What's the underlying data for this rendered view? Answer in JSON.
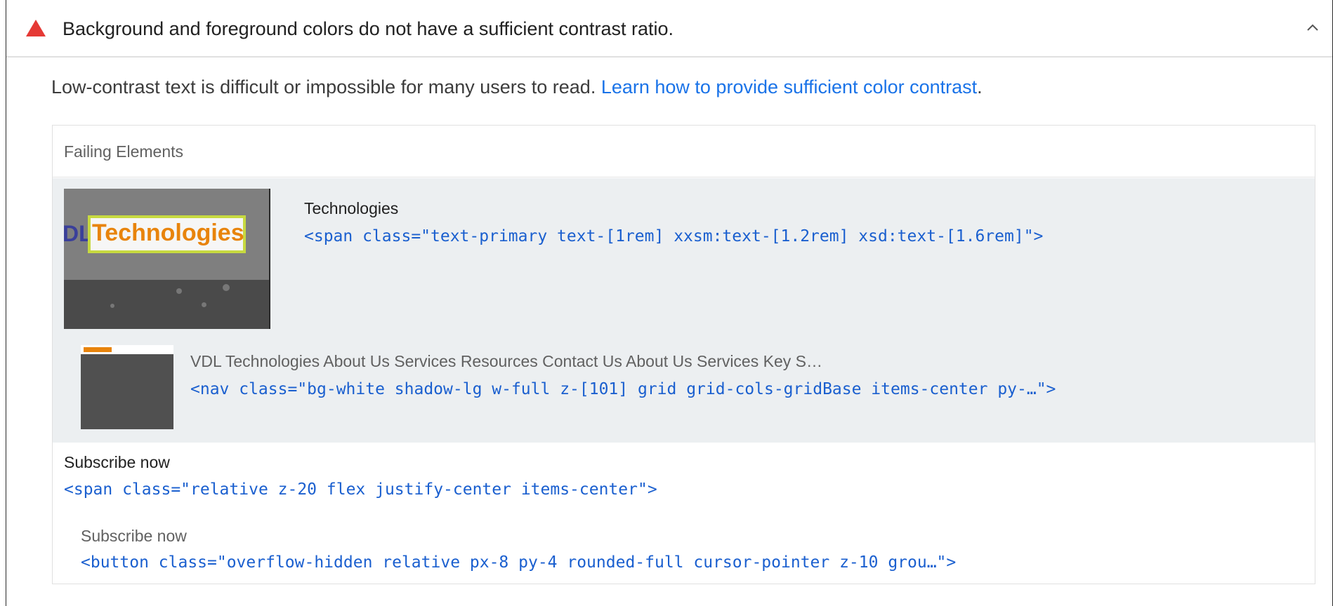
{
  "audit": {
    "title": "Background and foreground colors do not have a sufficient contrast ratio.",
    "description": "Low-contrast text is difficult or impossible for many users to read. ",
    "learn_link": "Learn how to provide sufficient color contrast",
    "description_end": ".",
    "status_color": "#e53935",
    "link_color": "#1a73e8"
  },
  "table": {
    "header": "Failing Elements",
    "rows": [
      {
        "label": "Technologies",
        "snippet": "<span class=\"text-primary text-[1rem] xxsm:text-[1.2rem] xsd:text-[1.6rem]\">",
        "thumb_text_vdl": "DL",
        "thumb_text": "Technologies"
      },
      {
        "label": "VDL Technologies About Us Services Resources Contact Us About Us Services Key S…",
        "snippet": "<nav class=\"bg-white shadow-lg w-full z-[101] grid grid-cols-gridBase items-center py-…\">"
      },
      {
        "label": "Subscribe now",
        "snippet": "<span class=\"relative z-20 flex justify-center items-center\">"
      },
      {
        "label": "Subscribe now",
        "snippet": "<button class=\"overflow-hidden relative px-8 py-4 rounded-full cursor-pointer z-10 grou…\">"
      }
    ]
  }
}
